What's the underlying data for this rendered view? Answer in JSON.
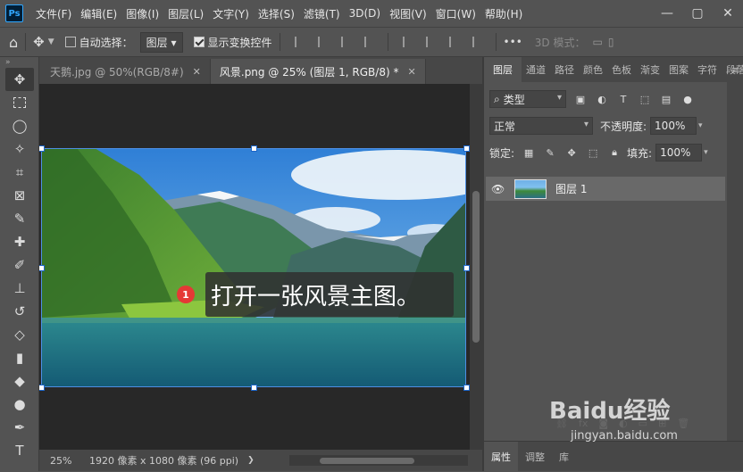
{
  "app": {
    "logo": "Ps"
  },
  "menu": [
    "文件(F)",
    "编辑(E)",
    "图像(I)",
    "图层(L)",
    "文字(Y)",
    "选择(S)",
    "滤镜(T)",
    "3D(D)",
    "视图(V)",
    "窗口(W)",
    "帮助(H)"
  ],
  "window_controls": {
    "minimize": "—",
    "restore": "▢",
    "close": "✕"
  },
  "options": {
    "auto_select_label": "自动选择：",
    "auto_select_value": "图层",
    "show_transform_label": "显示变换控件",
    "mode_3d_label": "3D 模式：",
    "more": "•••"
  },
  "tabs": [
    {
      "title": "天鹅.jpg @ 50%(RGB/8#)",
      "active": false
    },
    {
      "title": "风景.png @ 25% (图层 1, RGB/8) *",
      "active": true
    }
  ],
  "callout": {
    "badge": "1",
    "text": "打开一张风景主图。"
  },
  "status": {
    "zoom": "25%",
    "doc_info": "1920 像素 x 1080 像素 (96 ppi)",
    "arrow": "❯"
  },
  "panels": {
    "tabs": [
      "图层",
      "通道",
      "路径",
      "颜色",
      "色板",
      "渐变",
      "图案",
      "字符",
      "段落"
    ],
    "filter_label": "类型",
    "blend_mode": "正常",
    "opacity_label": "不透明度:",
    "opacity_value": "100%",
    "lock_label": "锁定:",
    "fill_label": "填充:",
    "fill_value": "100%",
    "layer_name": "图层 1",
    "bottom_tabs": [
      "属性",
      "调整",
      "库"
    ]
  },
  "watermark": {
    "brand": "Baidu经验",
    "url": "jingyan.baidu.com"
  },
  "colors": {
    "accent": "#31a8ff",
    "badge": "#e53935",
    "selection_handle": "#1d66c9"
  }
}
